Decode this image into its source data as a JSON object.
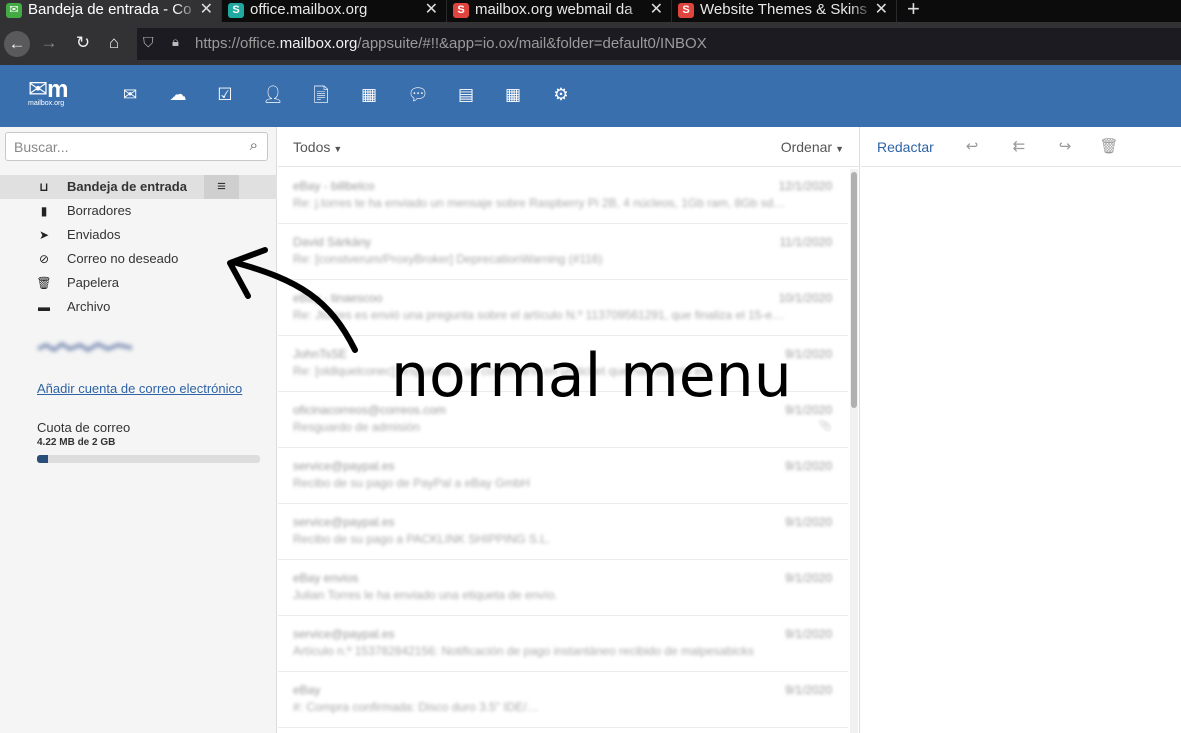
{
  "browser": {
    "tabs": [
      {
        "title": "Bandeja de entrada - Co",
        "favicon": "mail-envelope-icon",
        "favicon_color": "#44aa44",
        "active": true
      },
      {
        "title": "office.mailbox.org",
        "favicon": "s-logo-icon",
        "favicon_color": "#1fa9a0",
        "active": false
      },
      {
        "title": "mailbox.org webmail da",
        "favicon": "s-logo-icon",
        "favicon_color": "#e0443e",
        "active": false
      },
      {
        "title": "Website Themes & Skins",
        "favicon": "s-logo-icon",
        "favicon_color": "#e0443e",
        "active": false
      }
    ],
    "new_tab": "+",
    "url_prefix": "https://office.",
    "url_domain": "mailbox.org",
    "url_path": "/appsuite/#!!&app=io.ox/mail&folder=default0/INBOX"
  },
  "header": {
    "logo_text": "mailbox.org",
    "bg_color": "#3a6fae",
    "apps": [
      "mail-icon",
      "cloud-icon",
      "tasks-check-icon",
      "contacts-icon",
      "document-icon",
      "calendar-icon",
      "chat-icon",
      "presentation-icon",
      "spreadsheet-icon",
      "settings-gear-icon"
    ]
  },
  "sidebar": {
    "search_placeholder": "Buscar...",
    "folders": [
      {
        "label": "Bandeja de entrada",
        "icon": "inbox-icon",
        "selected": true
      },
      {
        "label": "Borradores",
        "icon": "draft-file-icon",
        "selected": false
      },
      {
        "label": "Enviados",
        "icon": "sent-plane-icon",
        "selected": false
      },
      {
        "label": "Correo no deseado",
        "icon": "spam-ban-icon",
        "selected": false
      },
      {
        "label": "Papelera",
        "icon": "trash-icon",
        "selected": false
      },
      {
        "label": "Archivo",
        "icon": "archive-box-icon",
        "selected": false
      }
    ],
    "add_account": "Añadir cuenta de correo electrónico",
    "quota_title": "Cuota de correo",
    "quota_value": "4.22 MB de 2 GB",
    "quota_fraction": 0.05
  },
  "list": {
    "filter_label": "Todos",
    "sort_label": "Ordenar",
    "mails": [
      {
        "from": "eBay - billbelco",
        "subject": "Re: j.torres te ha enviado un mensaje sobre Raspberry Pi 2B, 4 núcleos, 1Gb ram, 8Gb sd…",
        "date": "12/1/2020",
        "attachment": false
      },
      {
        "from": "David Sárkány",
        "subject": "Re: [constverum/ProxyBroker] DeprecationWarning (#116)",
        "date": "11/1/2020",
        "attachment": false
      },
      {
        "from": "eBay - tinaescoo",
        "subject": "Re: Jtorres es envió una pregunta sobre el artículo N.º 113709561291, que finaliza el 15-e…",
        "date": "10/1/2020",
        "attachment": false
      },
      {
        "from": "JohnTsSE",
        "subject": "Re: [oldlquelconec] respuesta a un comentario en un ticket que has abierto en…",
        "date": "9/1/2020",
        "attachment": false
      },
      {
        "from": "oficinacorreos@correos.com",
        "subject": "Resguardo de admisión",
        "date": "9/1/2020",
        "attachment": true
      },
      {
        "from": "service@paypal.es",
        "subject": "Recibo de su pago de PayPal a eBay GmbH",
        "date": "9/1/2020",
        "attachment": false
      },
      {
        "from": "service@paypal.es",
        "subject": "Recibo de su pago a PACKLINK SHIPPING S.L.",
        "date": "9/1/2020",
        "attachment": false
      },
      {
        "from": "eBay envios",
        "subject": "Julian Torres le ha enviado una etiqueta de envío.",
        "date": "9/1/2020",
        "attachment": false
      },
      {
        "from": "service@paypal.es",
        "subject": "Artículo n.º 153782842156: Notificación de pago instantáneo recibido de malpesabicks",
        "date": "9/1/2020",
        "attachment": false
      },
      {
        "from": "eBay",
        "subject": "#: Compra confirmada: Disco duro 3.5\" IDE/…",
        "date": "9/1/2020",
        "attachment": false
      }
    ]
  },
  "detail": {
    "compose_label": "Redactar",
    "actions": [
      "reply-icon",
      "reply-all-icon",
      "forward-icon",
      "delete-trash-icon"
    ]
  },
  "annotation": {
    "text": "normal menu"
  }
}
